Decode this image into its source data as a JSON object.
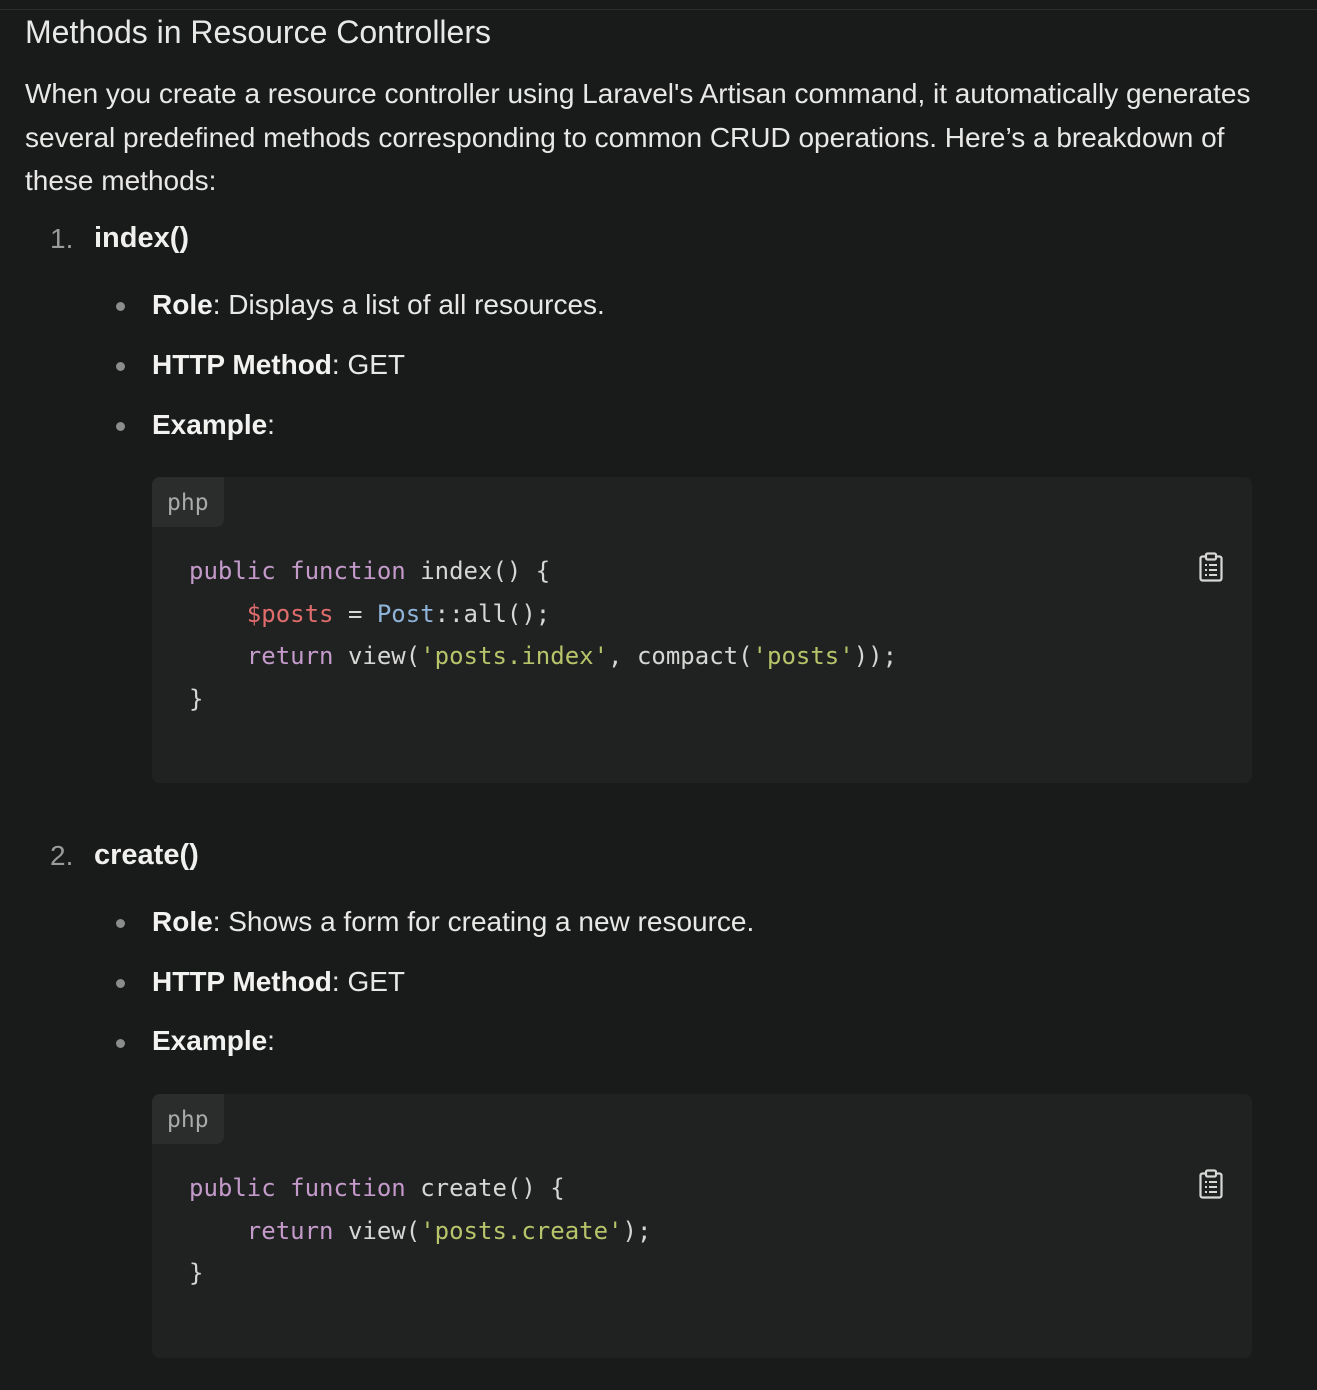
{
  "heading": "Methods in Resource Controllers",
  "intro": "When you create a resource controller using Laravel's Artisan command, it automatically generates several predefined methods corresponding to common CRUD operations. Here’s a breakdown of these methods:",
  "methods": [
    {
      "number": "1.",
      "name": "index()",
      "role_label": "Role",
      "role_text": ": Displays a list of all resources.",
      "http_label": "HTTP Method",
      "http_text": ": GET",
      "example_label": "Example",
      "example_text": ":",
      "code": {
        "language": "php",
        "line1": {
          "kw1": "public",
          "kw2": "function",
          "rest": " index() {"
        },
        "line2": {
          "var": "$posts",
          "op": " = ",
          "cls": "Post",
          "rest": "::all();"
        },
        "line3": {
          "kw": "return",
          "a": " view(",
          "s1": "'posts.index'",
          "b": ", compact(",
          "s2": "'posts'",
          "c": "));"
        },
        "line4": "}"
      }
    },
    {
      "number": "2.",
      "name": "create()",
      "role_label": "Role",
      "role_text": ": Shows a form for creating a new resource.",
      "http_label": "HTTP Method",
      "http_text": ": GET",
      "example_label": "Example",
      "example_text": ":",
      "code": {
        "language": "php",
        "line1": {
          "kw1": "public",
          "kw2": "function",
          "rest": " create() {"
        },
        "line2": {
          "kw": "return",
          "a": " view(",
          "s1": "'posts.create'",
          "b": ");"
        },
        "line3": "}"
      }
    }
  ],
  "icons": {
    "copy": "clipboard-icon"
  },
  "colors": {
    "background": "#191a1a",
    "code_bg": "#202222",
    "keyword": "#c39ac9",
    "variable": "#e06c6c",
    "class": "#8fb3d9",
    "string": "#b8c46a"
  }
}
